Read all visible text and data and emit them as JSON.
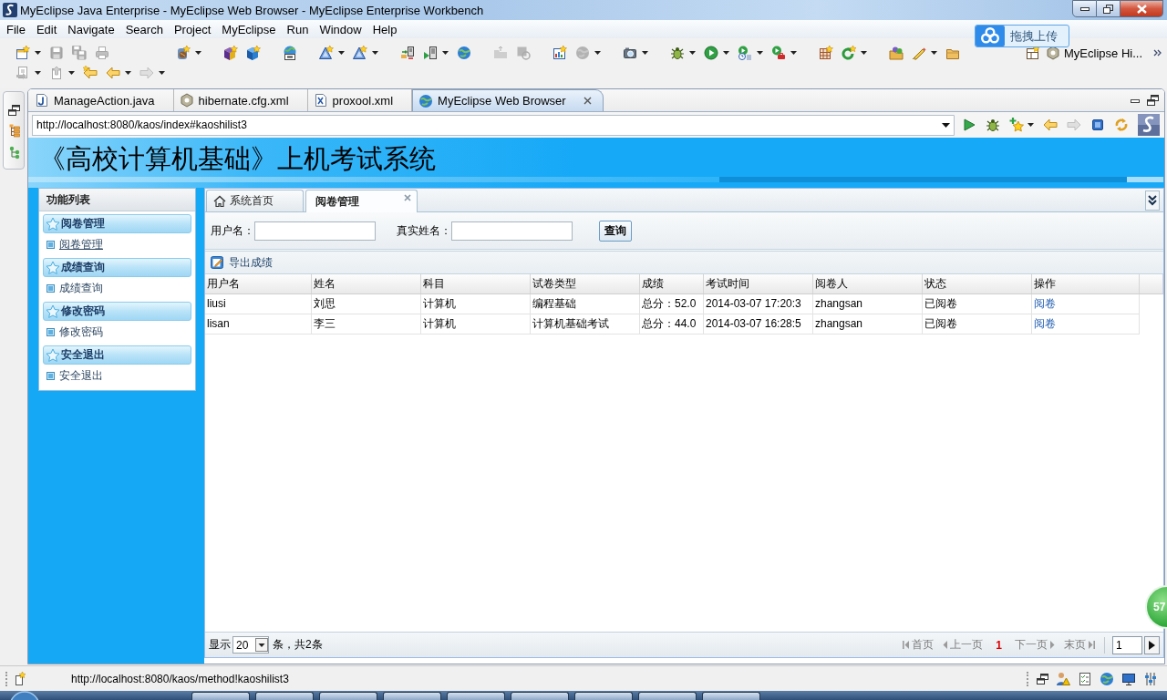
{
  "window": {
    "title": "MyEclipse Java Enterprise - MyEclipse Web Browser - MyEclipse Enterprise Workbench"
  },
  "menu": [
    "File",
    "Edit",
    "Navigate",
    "Search",
    "Project",
    "MyEclipse",
    "Run",
    "Window",
    "Help"
  ],
  "upload_widget": {
    "label": "拖拽上传"
  },
  "toolbar": {
    "rows": [
      [
        [
          {
            "kind": "new",
            "disabled": false,
            "dropdown": true
          },
          {
            "kind": "save",
            "disabled": true,
            "dropdown": false
          },
          {
            "kind": "saveall",
            "disabled": true,
            "dropdown": false
          },
          {
            "kind": "print",
            "disabled": true,
            "dropdown": false
          }
        ],
        [
          {
            "kind": "bean",
            "disabled": false,
            "dropdown": true
          }
        ],
        [
          {
            "kind": "cube",
            "disabled": false,
            "dropdown": false
          },
          {
            "kind": "cubeblue",
            "disabled": false,
            "dropdown": false
          }
        ],
        [
          {
            "kind": "webglobe",
            "disabled": false,
            "dropdown": false
          }
        ],
        [
          {
            "kind": "wizard",
            "disabled": false,
            "dropdown": true
          },
          {
            "kind": "wizard",
            "disabled": false,
            "dropdown": true
          }
        ],
        [
          {
            "kind": "deploy",
            "disabled": false,
            "dropdown": false
          },
          {
            "kind": "serverrun",
            "disabled": false,
            "dropdown": true
          },
          {
            "kind": "globe",
            "disabled": false,
            "dropdown": false
          }
        ],
        [
          {
            "kind": "folderout",
            "disabled": true,
            "dropdown": false
          },
          {
            "kind": "diskrefresh",
            "disabled": true,
            "dropdown": false
          }
        ],
        [
          {
            "kind": "chart",
            "disabled": false,
            "dropdown": false
          },
          {
            "kind": "globe",
            "disabled": true,
            "dropdown": true
          }
        ],
        [
          {
            "kind": "camera",
            "disabled": false,
            "dropdown": true
          }
        ],
        [
          {
            "kind": "bug",
            "disabled": false,
            "dropdown": true
          },
          {
            "kind": "run",
            "disabled": false,
            "dropdown": true
          },
          {
            "kind": "runclock",
            "disabled": false,
            "dropdown": true
          },
          {
            "kind": "runtool",
            "disabled": false,
            "dropdown": true
          }
        ],
        [
          {
            "kind": "grid",
            "disabled": false,
            "dropdown": false
          },
          {
            "kind": "refresh",
            "disabled": false,
            "dropdown": true
          }
        ],
        [
          {
            "kind": "folderball",
            "disabled": false,
            "dropdown": false
          },
          {
            "kind": "pen",
            "disabled": false,
            "dropdown": true
          },
          {
            "kind": "folder",
            "disabled": false,
            "dropdown": false
          }
        ]
      ],
      [
        [
          {
            "kind": "import",
            "disabled": true,
            "dropdown": true
          },
          {
            "kind": "up",
            "disabled": true,
            "dropdown": true
          },
          {
            "kind": "backstar",
            "disabled": false,
            "dropdown": false
          },
          {
            "kind": "back",
            "disabled": false,
            "dropdown": true
          },
          {
            "kind": "forward",
            "disabled": true,
            "dropdown": true
          }
        ]
      ]
    ]
  },
  "perspective": {
    "label": "MyEclipse Hi..."
  },
  "editor_tabs": [
    {
      "label": "ManageAction.java",
      "kind": "java",
      "selected": false
    },
    {
      "label": "hibernate.cfg.xml",
      "kind": "config",
      "selected": false
    },
    {
      "label": "proxool.xml",
      "kind": "xml",
      "selected": false
    },
    {
      "label": "MyEclipse Web Browser",
      "kind": "browser",
      "selected": true
    }
  ],
  "browser": {
    "url": "http://localhost:8080/kaos/index#kaoshilist3",
    "tools": [
      {
        "kind": "go",
        "disabled": false,
        "dropdown": false
      },
      {
        "kind": "bug",
        "disabled": false,
        "dropdown": false
      },
      {
        "kind": "bookmark",
        "disabled": false,
        "dropdown": true
      },
      {
        "kind": "back",
        "disabled": false,
        "dropdown": false
      },
      {
        "kind": "forward",
        "disabled": true,
        "dropdown": false
      },
      {
        "kind": "stop",
        "disabled": false,
        "dropdown": false
      },
      {
        "kind": "sync",
        "disabled": false,
        "dropdown": false
      }
    ]
  },
  "page": {
    "banner_title": "《高校计算机基础》上机考试系统",
    "sidebar": {
      "title": "功能列表",
      "groups": [
        {
          "title": "阅卷管理",
          "items": [
            {
              "label": "阅卷管理",
              "selected": true
            }
          ]
        },
        {
          "title": "成绩查询",
          "items": [
            {
              "label": "成绩查询",
              "selected": false
            }
          ]
        },
        {
          "title": "修改密码",
          "items": [
            {
              "label": "修改密码",
              "selected": false
            }
          ]
        },
        {
          "title": "安全退出",
          "items": [
            {
              "label": "安全退出",
              "selected": false
            }
          ]
        }
      ]
    },
    "tabs": [
      {
        "label": "系统首页",
        "kind": "home",
        "selected": false,
        "closable": false
      },
      {
        "label": "阅卷管理",
        "kind": "page",
        "selected": true,
        "closable": true
      }
    ],
    "search": {
      "fields": [
        {
          "label": "用户名："
        },
        {
          "label": "真实姓名："
        }
      ],
      "button": "查询"
    },
    "actions": [
      {
        "label": "导出成绩"
      }
    ],
    "table": {
      "columns": [
        {
          "label": "用户名",
          "kind": "text"
        },
        {
          "label": "姓名",
          "kind": "text"
        },
        {
          "label": "科目",
          "kind": "text"
        },
        {
          "label": "试卷类型",
          "kind": "text"
        },
        {
          "label": "成绩",
          "kind": "text"
        },
        {
          "label": "考试时间",
          "kind": "text"
        },
        {
          "label": "阅卷人",
          "kind": "text"
        },
        {
          "label": "状态",
          "kind": "text"
        },
        {
          "label": "操作",
          "kind": "link"
        }
      ],
      "rows": [
        [
          "liusi",
          "刘思",
          "计算机",
          "编程基础",
          "总分：52.0",
          "2014-03-07 17:20:3",
          "zhangsan",
          "已阅卷",
          "阅卷"
        ],
        [
          "lisan",
          "李三",
          "计算机",
          "计算机基础考试",
          "总分：44.0",
          "2014-03-07 16:28:5",
          "zhangsan",
          "已阅卷",
          "阅卷"
        ]
      ]
    },
    "pager": {
      "show_label": "显示",
      "page_size": "20",
      "summary": "条，共2条",
      "items": [
        {
          "label": "首页",
          "kind": "first",
          "disabled": true
        },
        {
          "label": "上一页",
          "kind": "prev",
          "disabled": true
        },
        {
          "label": "1",
          "kind": "current",
          "disabled": false
        },
        {
          "label": "下一页",
          "kind": "next",
          "disabled": true
        },
        {
          "label": "末页",
          "kind": "last",
          "disabled": true
        }
      ],
      "page_input": "1"
    }
  },
  "floating_badge": {
    "label": "57"
  },
  "status_bar": {
    "text": "http://localhost:8080/kaos/method!kaoshilist3"
  }
}
